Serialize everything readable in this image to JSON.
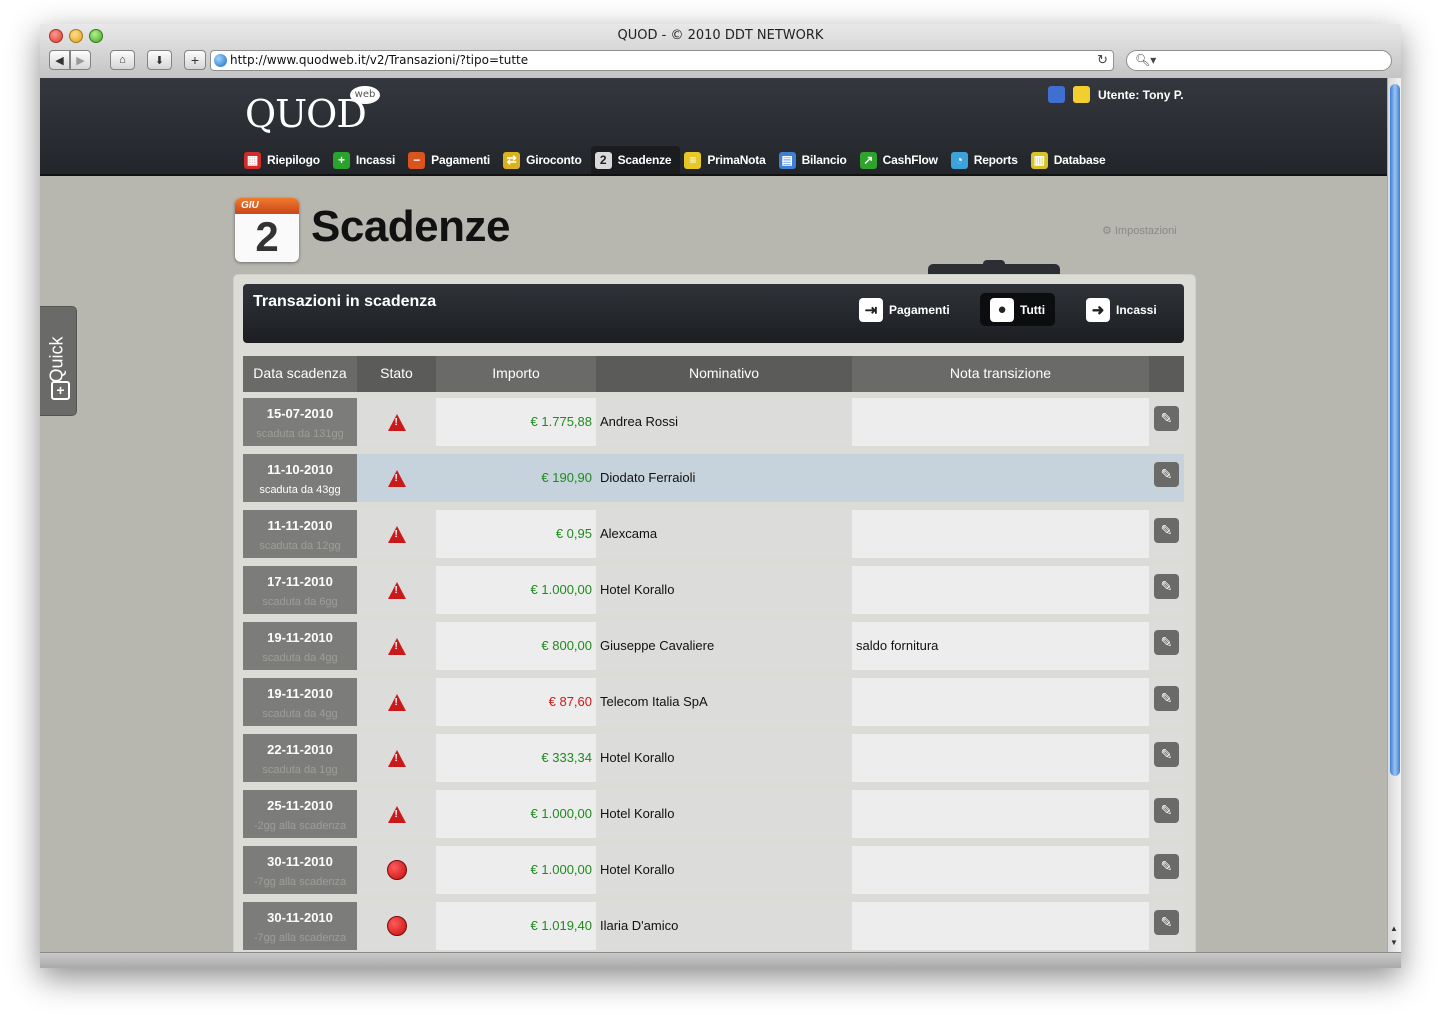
{
  "window": {
    "title": "QUOD - © 2010 DDT NETWORK",
    "url": "http://www.quodweb.it/v2/Transazioni/?tipo=tutte",
    "search_placeholder": ""
  },
  "header": {
    "logo": "QUOD",
    "logo_badge": "web",
    "user_label": "Utente: Tony P."
  },
  "nav": [
    {
      "label": "Riepilogo",
      "icon": "calendar-icon",
      "color": "#d12b2b"
    },
    {
      "label": "Incassi",
      "icon": "plus-icon",
      "color": "#29a32b"
    },
    {
      "label": "Pagamenti",
      "icon": "minus-icon",
      "color": "#d9541e"
    },
    {
      "label": "Giroconto",
      "icon": "exchange-icon",
      "color": "#d9b21e"
    },
    {
      "label": "Scadenze",
      "icon": "due-date-icon",
      "color": "#d9d9d9",
      "active": true
    },
    {
      "label": "PrimaNota",
      "icon": "notes-icon",
      "color": "#e6c926"
    },
    {
      "label": "Bilancio",
      "icon": "balance-icon",
      "color": "#3f7fd6"
    },
    {
      "label": "CashFlow",
      "icon": "chart-icon",
      "color": "#2fa32b"
    },
    {
      "label": "Reports",
      "icon": "report-icon",
      "color": "#3ba3d9"
    },
    {
      "label": "Database",
      "icon": "database-icon",
      "color": "#d9c226"
    }
  ],
  "page": {
    "calendar_month": "GIU",
    "calendar_day": "2",
    "title": "Scadenze",
    "settings_label": "Impostazioni"
  },
  "panel": {
    "title": "Transazioni in scadenza",
    "filters": [
      {
        "label": "Pagamenti",
        "active": false
      },
      {
        "label": "Tutti",
        "active": true
      },
      {
        "label": "Incassi",
        "active": false
      }
    ],
    "columns": [
      "Data scadenza",
      "Stato",
      "Importo",
      "Nominativo",
      "Nota transizione",
      ""
    ],
    "rows": [
      {
        "date": "15-07-2010",
        "status_text": "scaduta da 131gg",
        "status": "warning",
        "amount": "€ 1.775,88",
        "amount_color": "green",
        "name": "Andrea Rossi",
        "note": ""
      },
      {
        "date": "11-10-2010",
        "status_text": "scaduta da 43gg",
        "status": "warning",
        "amount": "€ 190,90",
        "amount_color": "green",
        "name": "Diodato Ferraioli",
        "note": "",
        "selected": true
      },
      {
        "date": "11-11-2010",
        "status_text": "scaduta da 12gg",
        "status": "warning",
        "amount": "€ 0,95",
        "amount_color": "green",
        "name": "Alexcama",
        "note": ""
      },
      {
        "date": "17-11-2010",
        "status_text": "scaduta da 6gg",
        "status": "warning",
        "amount": "€ 1.000,00",
        "amount_color": "green",
        "name": "Hotel Korallo",
        "note": ""
      },
      {
        "date": "19-11-2010",
        "status_text": "scaduta da 4gg",
        "status": "warning",
        "amount": "€ 800,00",
        "amount_color": "green",
        "name": "Giuseppe Cavaliere",
        "note": "saldo fornitura"
      },
      {
        "date": "19-11-2010",
        "status_text": "scaduta da 4gg",
        "status": "warning",
        "amount": "€ 87,60",
        "amount_color": "red",
        "name": "Telecom Italia SpA",
        "note": ""
      },
      {
        "date": "22-11-2010",
        "status_text": "scaduta da 1gg",
        "status": "warning",
        "amount": "€ 333,34",
        "amount_color": "green",
        "name": "Hotel Korallo",
        "note": ""
      },
      {
        "date": "25-11-2010",
        "status_text": "-2gg alla scadenza",
        "status": "warning",
        "amount": "€ 1.000,00",
        "amount_color": "green",
        "name": "Hotel Korallo",
        "note": ""
      },
      {
        "date": "30-11-2010",
        "status_text": "-7gg alla scadenza",
        "status": "due",
        "amount": "€ 1.000,00",
        "amount_color": "green",
        "name": "Hotel Korallo",
        "note": ""
      },
      {
        "date": "30-11-2010",
        "status_text": "-7gg alla scadenza",
        "status": "due",
        "amount": "€ 1.019,40",
        "amount_color": "green",
        "name": "Ilaria D'amico",
        "note": ""
      }
    ]
  },
  "quick": {
    "label": "Quick"
  }
}
